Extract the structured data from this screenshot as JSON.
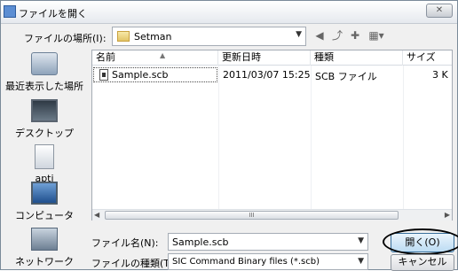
{
  "window": {
    "title": "ファイルを開く",
    "close_label": "✕"
  },
  "location": {
    "label": "ファイルの場所(I):",
    "value": "Setman"
  },
  "toolbar": {
    "back_icon": "back-icon",
    "up_icon": "up-folder-icon",
    "new_folder_icon": "new-folder-icon",
    "view_icon": "view-menu-icon"
  },
  "places": [
    {
      "label": "最近表示した場所",
      "icon": "recent-places-icon"
    },
    {
      "label": "デスクトップ",
      "icon": "desktop-icon"
    },
    {
      "label": "apti",
      "icon": "user-folder-icon"
    },
    {
      "label": "コンピュータ",
      "icon": "computer-icon"
    },
    {
      "label": "ネットワーク",
      "icon": "network-icon"
    }
  ],
  "columns": {
    "name": "名前",
    "date": "更新日時",
    "type": "種類",
    "size": "サイズ"
  },
  "files": [
    {
      "name": "Sample.scb",
      "date": "2011/03/07 15:25",
      "type": "SCB ファイル",
      "size": "3 K"
    }
  ],
  "scrollbar": {
    "thumb_grip": "III"
  },
  "filename": {
    "label": "ファイル名(N):",
    "value": "Sample.scb"
  },
  "filetype": {
    "label": "ファイルの種類(T):",
    "value": "SIC Command Binary files (*.scb)"
  },
  "buttons": {
    "open": "開く(O)",
    "cancel": "キャンセル"
  }
}
